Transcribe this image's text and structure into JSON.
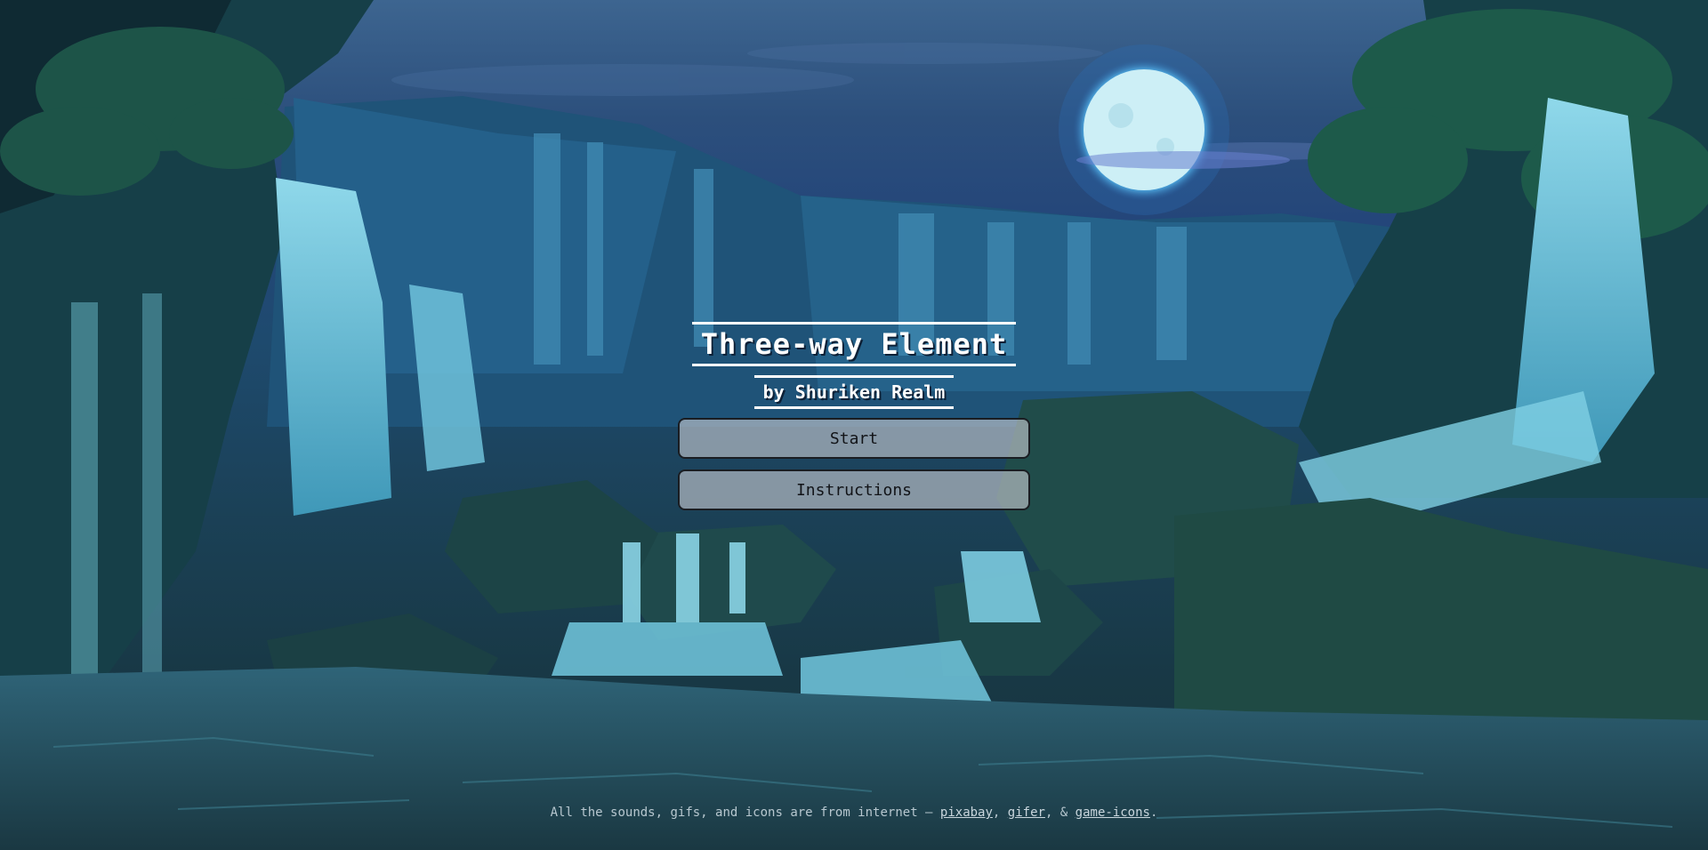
{
  "game": {
    "title": "Three-way Element",
    "subtitle": "by Shuriken Realm"
  },
  "menu": {
    "start_label": "Start",
    "instructions_label": "Instructions"
  },
  "footer": {
    "text_before": "All the sounds, gifs, and icons are from internet — ",
    "link_pixabay": "pixabay",
    "sep1": ", ",
    "link_gifer": "gifer",
    "sep2": ", & ",
    "link_gameicons": "game-icons",
    "text_after": "."
  },
  "colors": {
    "sky": "#2c4f7c",
    "moon": "#d6f2f8",
    "water": "#5fb6d0",
    "rock": "#1f4a4f",
    "button_bg": "#c8cad0"
  },
  "background": {
    "scene_description_icons": [
      "moon-icon",
      "waterfall-icon",
      "rock-icon",
      "tree-icon"
    ]
  }
}
